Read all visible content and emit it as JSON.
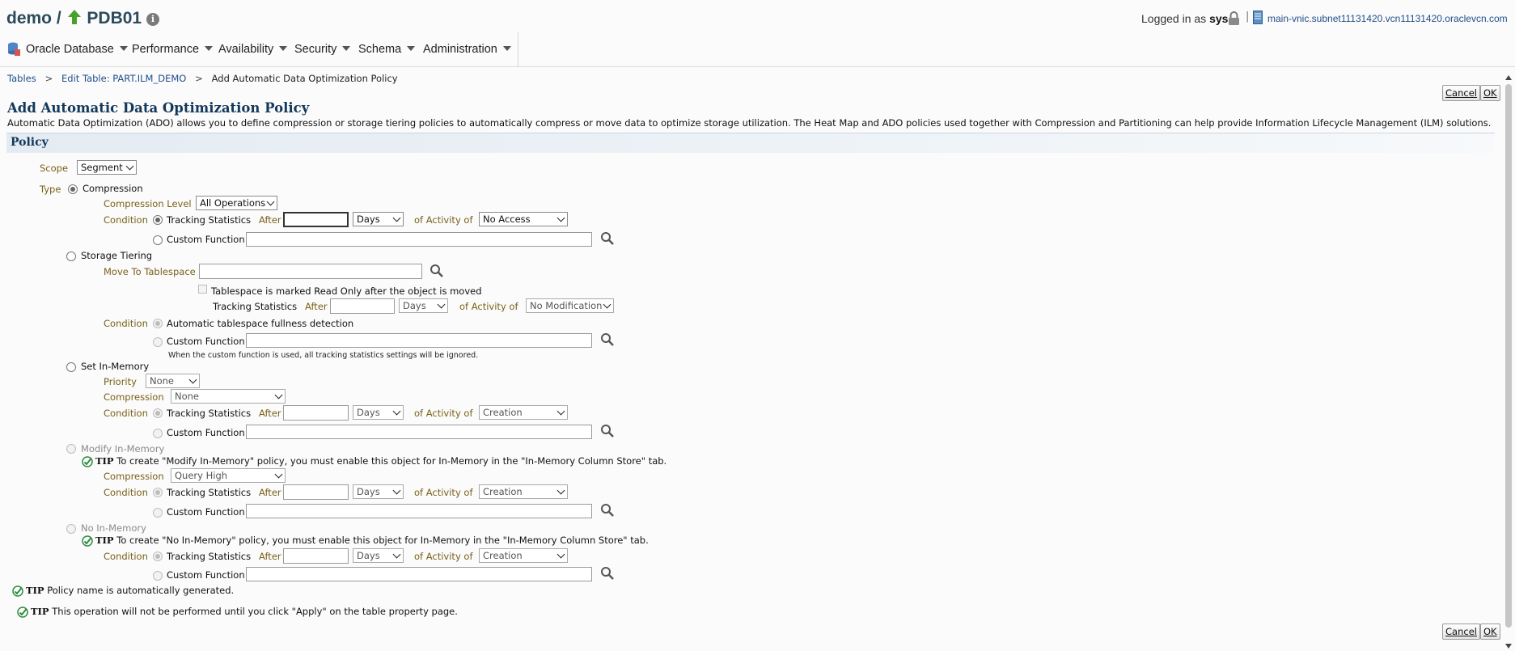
{
  "header": {
    "db_name": "demo",
    "slash": "/",
    "pdb_name": "PDB01",
    "info_icon": "i",
    "logged_in_label": "Logged in as",
    "user": "sys",
    "divider": "|",
    "host": "main-vnic.subnet11131420.vcn11131420.oraclevcn.com"
  },
  "menu": [
    "Oracle Database",
    "Performance",
    "Availability",
    "Security",
    "Schema",
    "Administration"
  ],
  "breadcrumb": {
    "items": [
      "Tables",
      "Edit Table: PART.ILM_DEMO"
    ],
    "separator": ">",
    "current": "Add Automatic Data Optimization Policy"
  },
  "buttons": {
    "cancel": "Cancel",
    "ok": "OK"
  },
  "page": {
    "title": "Add Automatic Data Optimization Policy",
    "description": "Automatic Data Optimization (ADO) allows you to define compression or storage tiering policies to automatically compress or move data to optimize storage utilization. The Heat Map and ADO policies used together with Compression and Partitioning can help provide Information Lifecycle Management (ILM) solutions.",
    "section": "Policy"
  },
  "labels": {
    "scope": "Scope",
    "type": "Type",
    "compression_level": "Compression Level",
    "condition": "Condition",
    "tracking_statistics": "Tracking Statistics",
    "after": "After",
    "of_activity_of": "of Activity of",
    "custom_function": "Custom Function",
    "move_to_tablespace": "Move To Tablespace",
    "readonly_check": "Tablespace is marked Read Only after the object is moved",
    "auto_fullness": "Automatic tablespace fullness detection",
    "custom_note": "When the custom function is used, all tracking statistics settings will be ignored.",
    "priority": "Priority",
    "compression": "Compression"
  },
  "selects": {
    "scope": "Segment",
    "compression_level": "All Operations",
    "days": "Days",
    "activity_no_access": "No Access",
    "activity_no_modification": "No Modification",
    "activity_creation": "Creation",
    "priority": "None",
    "inmem_compression": "None",
    "modify_compression": "Query High"
  },
  "types": {
    "compression": "Compression",
    "storage_tiering": "Storage Tiering",
    "set_inmemory": "Set In-Memory",
    "modify_inmemory": "Modify In-Memory",
    "no_inmemory": "No In-Memory"
  },
  "tips": {
    "label": "TIP",
    "modify": "To create \"Modify In-Memory\" policy, you must enable this object for In-Memory in the \"In-Memory Column Store\" tab.",
    "no_inmem": "To create \"No In-Memory\" policy, you must enable this object for In-Memory in the \"In-Memory Column Store\" tab.",
    "policy_name": "Policy name is automatically generated.",
    "apply": "This operation will not be performed until you click \"Apply\" on the table property page."
  },
  "colors": {
    "title": "#2b4b5c",
    "heading": "#12385a",
    "label": "#7a6018",
    "link": "#1f4e8a",
    "tip_check": "#2e8b3e"
  }
}
